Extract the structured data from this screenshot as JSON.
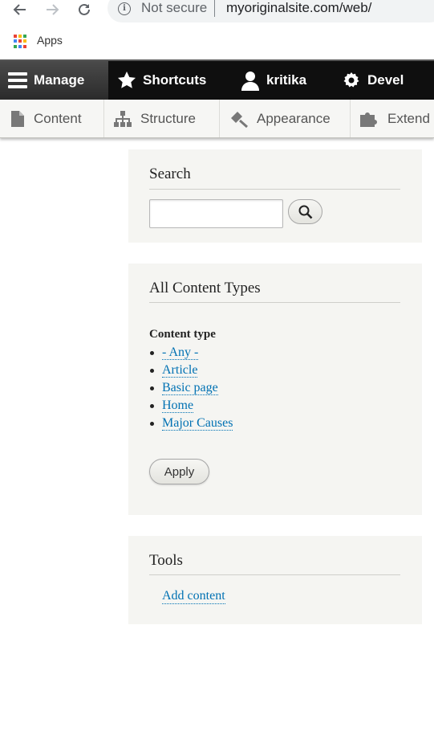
{
  "browser": {
    "security_label": "Not secure",
    "url": "myoriginalsite.com/web/",
    "bookmarks": {
      "apps_label": "Apps"
    },
    "icons": [
      "back-arrow-icon",
      "forward-arrow-icon",
      "reload-icon",
      "info-icon",
      "apps-grid-icon"
    ]
  },
  "toolbar": {
    "items": [
      {
        "label": "Manage",
        "icon": "hamburger-icon"
      },
      {
        "label": "Shortcuts",
        "icon": "star-icon"
      },
      {
        "label": "kritika",
        "icon": "user-icon"
      },
      {
        "label": "Devel",
        "icon": "gear-icon"
      }
    ],
    "tray": [
      {
        "label": "Content",
        "icon": "page-icon"
      },
      {
        "label": "Structure",
        "icon": "sitemap-icon"
      },
      {
        "label": "Appearance",
        "icon": "paintbrush-icon"
      },
      {
        "label": "Extend",
        "icon": "puzzle-icon"
      }
    ]
  },
  "search_block": {
    "title": "Search",
    "input_value": "",
    "button_icon": "search-icon"
  },
  "content_types_block": {
    "title": "All Content Types",
    "facet_label": "Content type",
    "options": [
      "- Any -",
      "Article",
      "Basic page",
      "Home",
      "Major Causes"
    ],
    "apply_label": "Apply"
  },
  "tools_block": {
    "title": "Tools",
    "link": "Add content"
  },
  "colors": {
    "link": "#0071b3",
    "toolbar_bg": "#0f0f0f",
    "block_bg": "#f5f5f2"
  }
}
